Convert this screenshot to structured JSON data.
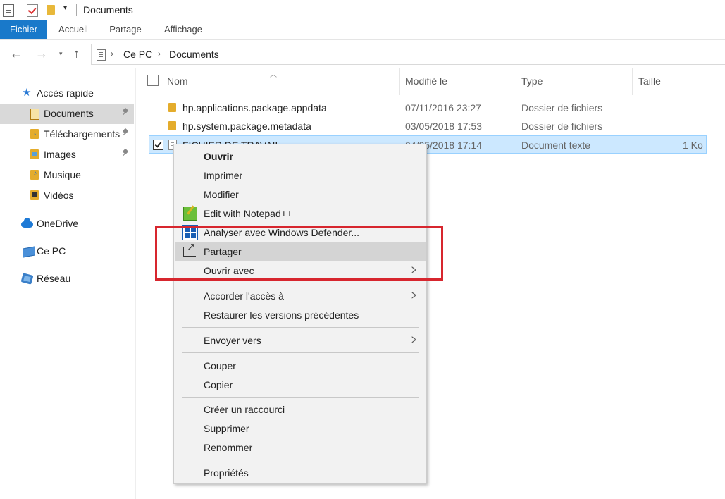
{
  "window": {
    "title": "Documents"
  },
  "ribbon": {
    "tabs": [
      "Fichier",
      "Accueil",
      "Partage",
      "Affichage"
    ]
  },
  "address": {
    "crumbs": [
      "Ce PC",
      "Documents"
    ]
  },
  "nav": {
    "items": [
      {
        "label": "Accès rapide"
      },
      {
        "label": "Documents"
      },
      {
        "label": "Téléchargements"
      },
      {
        "label": "Images"
      },
      {
        "label": "Musique"
      },
      {
        "label": "Vidéos"
      },
      {
        "label": "OneDrive"
      },
      {
        "label": "Ce PC"
      },
      {
        "label": "Réseau"
      }
    ]
  },
  "columns": {
    "name": "Nom",
    "modified": "Modifié le",
    "type": "Type",
    "size": "Taille"
  },
  "files": [
    {
      "name": "hp.applications.package.appdata",
      "modified": "07/11/2016 23:27",
      "type": "Dossier de fichiers",
      "size": ""
    },
    {
      "name": "hp.system.package.metadata",
      "modified": "03/05/2018 17:53",
      "type": "Dossier de fichiers",
      "size": ""
    },
    {
      "name": "FICHIER DE TRAVAIL",
      "modified": "04/05/2018 17:14",
      "type": "Document texte",
      "size": "1 Ko"
    }
  ],
  "context_menu": {
    "items": [
      "Ouvrir",
      "Imprimer",
      "Modifier",
      "Edit with Notepad++",
      "Analyser avec Windows Defender...",
      "Partager",
      "Ouvrir avec",
      "Accorder l'accès à",
      "Restaurer les versions précédentes",
      "Envoyer vers",
      "Couper",
      "Copier",
      "Créer un raccourci",
      "Supprimer",
      "Renommer",
      "Propriétés"
    ]
  },
  "colors": {
    "accent": "#1979ca",
    "highlight_box": "#d7262e",
    "selection": "#cce8ff"
  }
}
